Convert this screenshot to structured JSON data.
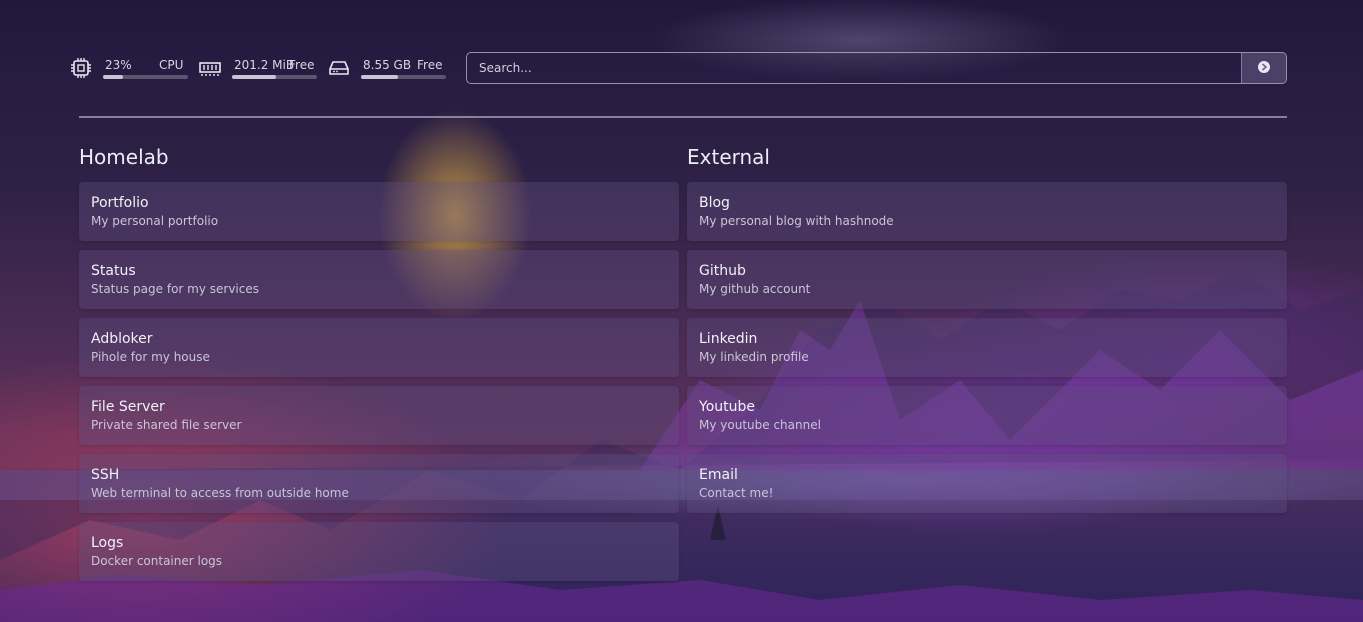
{
  "stats": {
    "cpu": {
      "value": "23%",
      "label": "CPU",
      "level": 0.23,
      "icon": "cpu-icon"
    },
    "memory": {
      "value": "201.2 MiB",
      "label": "Free",
      "level": 0.52,
      "icon": "memory-icon"
    },
    "disk": {
      "value": "8.55 GB",
      "label": "Free",
      "level": 0.43,
      "icon": "disk-icon"
    }
  },
  "search": {
    "placeholder": "Search...",
    "icon": "search-submit-icon"
  },
  "homelab": {
    "title": "Homelab",
    "items": [
      {
        "title": "Portfolio",
        "description": "My personal portfolio"
      },
      {
        "title": "Status",
        "description": "Status page for my services"
      },
      {
        "title": "Adbloker",
        "description": "Pihole for my house"
      },
      {
        "title": "File Server",
        "description": "Private shared file server"
      },
      {
        "title": "SSH",
        "description": "Web terminal to access from outside home"
      },
      {
        "title": "Logs",
        "description": "Docker container logs"
      }
    ]
  },
  "external": {
    "title": "External",
    "items": [
      {
        "title": "Blog",
        "description": "My personal blog with hashnode"
      },
      {
        "title": "Github",
        "description": "My github account"
      },
      {
        "title": "Linkedin",
        "description": "My linkedin profile"
      },
      {
        "title": "Youtube",
        "description": "My youtube channel"
      },
      {
        "title": "Email",
        "description": "Contact me!"
      }
    ]
  },
  "colors": {
    "accent": "#e6e6ee",
    "card": "#5f5082",
    "background_top": "#21183e",
    "background_bottom": "#2c2358"
  }
}
